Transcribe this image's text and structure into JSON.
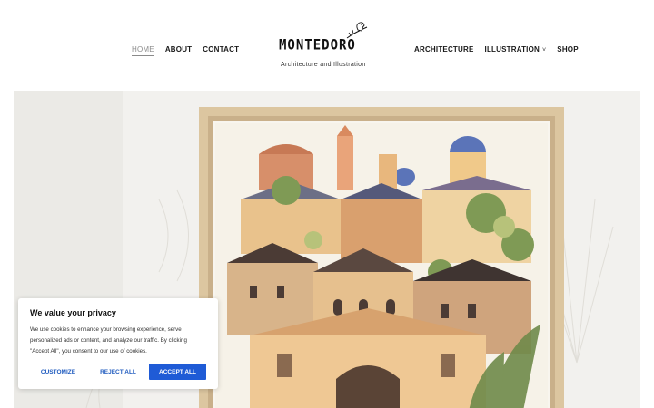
{
  "nav": {
    "left": [
      {
        "label": "HOME",
        "active": true
      },
      {
        "label": "ABOUT"
      },
      {
        "label": "CONTACT"
      }
    ],
    "right": [
      {
        "label": "ARCHITECTURE"
      },
      {
        "label": "ILLUSTRATION",
        "caret": "˅"
      },
      {
        "label": "SHOP"
      }
    ]
  },
  "logo": {
    "wordmark": "MONTEDORO",
    "tagline": "Architecture and Illustration",
    "icon": "bird-on-branch-icon"
  },
  "hero": {
    "image": "framed-watercolor-townscape-illustration"
  },
  "cookie_banner": {
    "title": "We value your privacy",
    "body": "We use cookies to enhance your browsing experience, serve personalized ads or content, and analyze our traffic. By clicking \"Accept All\", you consent to our use of cookies.",
    "customize_label": "CUSTOMIZE",
    "reject_label": "REJECT ALL",
    "accept_label": "ACCEPT ALL",
    "accent_color": "#1f5bd6"
  },
  "colors": {
    "nav_active": "#8a8a8a",
    "text": "#1a1a1a",
    "frame_wood": "#d9c29a"
  }
}
